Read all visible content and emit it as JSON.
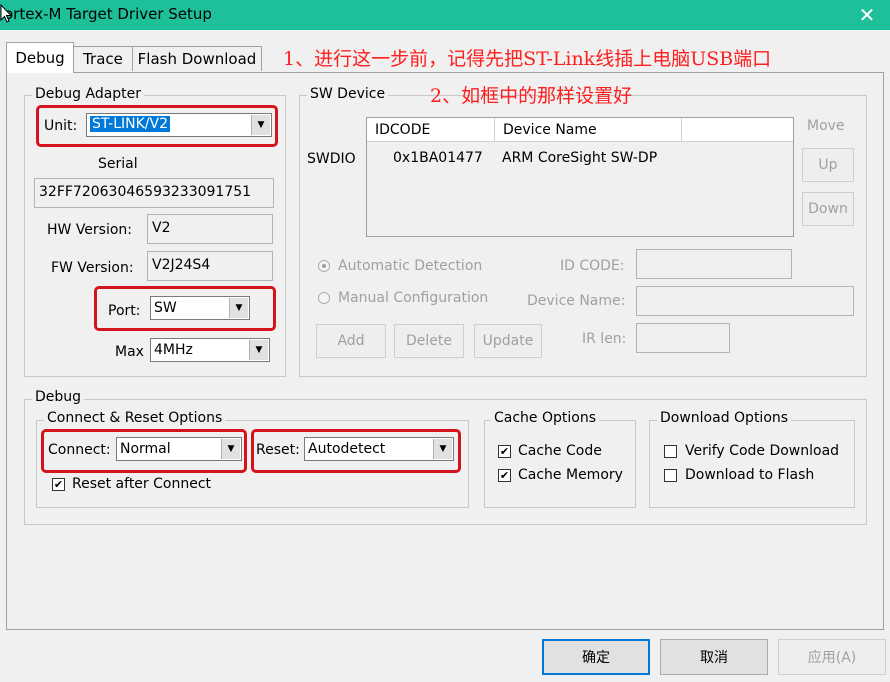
{
  "window": {
    "title": "ortex-M Target Driver Setup",
    "close_glyph": "✕"
  },
  "tabs": [
    {
      "label": "Debug"
    },
    {
      "label": "Trace"
    },
    {
      "label": "Flash Download"
    }
  ],
  "annotations": {
    "note1": "1、进行这一步前，记得先把ST-Link线插上电脑USB端口",
    "note2": "2、如框中的那样设置好",
    "color": "#d4141c"
  },
  "debug_adapter": {
    "group_label": "Debug Adapter",
    "unit_label": "Unit:",
    "unit_value": "ST-LINK/V2",
    "serial_label": "Serial",
    "serial_value": "32FF72063046593233091751",
    "hw_label": "HW Version:",
    "hw_value": "V2",
    "fw_label": "FW Version:",
    "fw_value": "V2J24S4",
    "port_label": "Port:",
    "port_value": "SW",
    "max_label": "Max",
    "max_value": "4MHz"
  },
  "sw_device": {
    "group_label": "SW Device",
    "move_label": "Move",
    "up_label": "Up",
    "down_label": "Down",
    "columns": [
      "IDCODE",
      "Device Name"
    ],
    "rows": [
      {
        "type": "SWDIO",
        "idcode": "0x1BA01477",
        "device_name": "ARM CoreSight SW-DP"
      }
    ],
    "auto_detect_label": "Automatic Detection",
    "manual_config_label": "Manual Configuration",
    "id_code_label": "ID CODE:",
    "device_name_label": "Device Name:",
    "ir_len_label": "IR len:",
    "add_label": "Add",
    "delete_label": "Delete",
    "update_label": "Update"
  },
  "debug": {
    "group_label": "Debug",
    "connect_reset": {
      "group_label": "Connect & Reset Options",
      "connect_label": "Connect:",
      "connect_value": "Normal",
      "reset_label": "Reset:",
      "reset_value": "Autodetect",
      "reset_after_connect_label": "Reset after Connect",
      "reset_after_connect_checked": true
    },
    "cache": {
      "group_label": "Cache Options",
      "cache_code_label": "Cache Code",
      "cache_code_checked": true,
      "cache_memory_label": "Cache Memory",
      "cache_memory_checked": true
    },
    "download": {
      "group_label": "Download Options",
      "verify_label": "Verify Code Download",
      "verify_checked": false,
      "flash_label": "Download to Flash",
      "flash_checked": false
    }
  },
  "footer": {
    "ok_label": "确定",
    "cancel_label": "取消",
    "apply_label": "应用(A)"
  },
  "checkmark": "✔",
  "dropdown_arrow": "▼"
}
